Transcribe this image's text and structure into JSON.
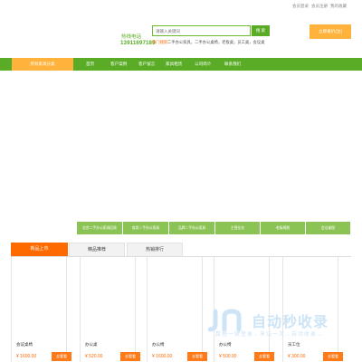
{
  "top_links": [
    "会员登录",
    "会员注册",
    "我的收藏"
  ],
  "header": {
    "hotline_label": "热线电话",
    "hotline_number": "13911697189",
    "search_placeholder": "请输入关键词",
    "search_button": "搜 索",
    "hot_label": "热门搜索：",
    "hot_links": "二手办公家具，二手办公桌椅，老板桌，员工桌，会议桌",
    "cta_button": "立即报价(注)"
  },
  "nav": {
    "all_categories": "所有家具分类",
    "items": [
      "首页",
      "客户案例",
      "客户留言",
      "家具租赁",
      "公司简介",
      "联系我们"
    ]
  },
  "categories": [
    "北京二手办公家具回收",
    "各类二手办公家具",
    "品牌二手办公家具",
    "主营业务",
    "老板椅图",
    "会议桌图"
  ],
  "tabs": [
    "新品上市",
    "精品推荐",
    "热销排行"
  ],
  "products": [
    {
      "title": "会议桌椅",
      "price": "¥ 1600.00",
      "button": "去看看"
    },
    {
      "title": "办公桌",
      "price": "¥ 520.00",
      "button": "去看看"
    },
    {
      "title": "办公椅",
      "price": "¥ 1600.00",
      "button": "去看看"
    },
    {
      "title": "办公椅",
      "price": "¥ 500.00",
      "button": "去看看"
    },
    {
      "title": "员工位",
      "price": "¥ 300.00",
      "button": "去看看"
    }
  ],
  "watermark": {
    "brand": "自动秒收录",
    "slogan": "数据一键登录→来访一次→自动收录→"
  },
  "colors": {
    "green": "#5aac26",
    "light_green": "#8cc355",
    "orange": "#ff6a00",
    "amber": "#ffb33c"
  }
}
